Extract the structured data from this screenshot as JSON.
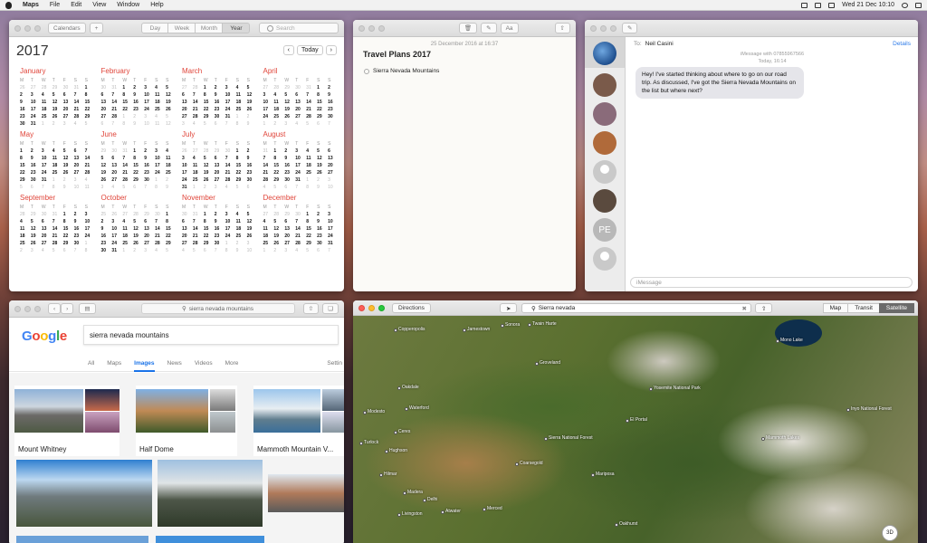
{
  "menubar": {
    "app": "Maps",
    "items": [
      "File",
      "Edit",
      "View",
      "Window",
      "Help"
    ],
    "datetime": "Wed 21 Dec 10:10"
  },
  "calendar": {
    "calendars_btn": "Calendars",
    "add_btn": "+",
    "views": [
      "Day",
      "Week",
      "Month",
      "Year"
    ],
    "selected_view": "Year",
    "search_placeholder": "Search",
    "year": "2017",
    "today": "Today",
    "weekday_header": [
      "M",
      "T",
      "W",
      "T",
      "F",
      "S",
      "S"
    ],
    "months": [
      {
        "name": "January",
        "weeks": [
          [
            "26",
            "27",
            "28",
            "29",
            "30",
            "31",
            "1"
          ],
          [
            "2",
            "3",
            "4",
            "5",
            "6",
            "7",
            "8"
          ],
          [
            "9",
            "10",
            "11",
            "12",
            "13",
            "14",
            "15"
          ],
          [
            "16",
            "17",
            "18",
            "19",
            "20",
            "21",
            "22"
          ],
          [
            "23",
            "24",
            "25",
            "26",
            "27",
            "28",
            "29"
          ],
          [
            "30",
            "31",
            "1",
            "2",
            "3",
            "4",
            "5"
          ]
        ]
      },
      {
        "name": "February",
        "weeks": [
          [
            "30",
            "31",
            "1",
            "2",
            "3",
            "4",
            "5"
          ],
          [
            "6",
            "7",
            "8",
            "9",
            "10",
            "11",
            "12"
          ],
          [
            "13",
            "14",
            "15",
            "16",
            "17",
            "18",
            "19"
          ],
          [
            "20",
            "21",
            "22",
            "23",
            "24",
            "25",
            "26"
          ],
          [
            "27",
            "28",
            "1",
            "2",
            "3",
            "4",
            "5"
          ],
          [
            "6",
            "7",
            "8",
            "9",
            "10",
            "11",
            "12"
          ]
        ]
      },
      {
        "name": "March",
        "weeks": [
          [
            "27",
            "28",
            "1",
            "2",
            "3",
            "4",
            "5"
          ],
          [
            "6",
            "7",
            "8",
            "9",
            "10",
            "11",
            "12"
          ],
          [
            "13",
            "14",
            "15",
            "16",
            "17",
            "18",
            "19"
          ],
          [
            "20",
            "21",
            "22",
            "23",
            "24",
            "25",
            "26"
          ],
          [
            "27",
            "28",
            "29",
            "30",
            "31",
            "1",
            "2"
          ],
          [
            "3",
            "4",
            "5",
            "6",
            "7",
            "8",
            "9"
          ]
        ]
      },
      {
        "name": "April",
        "weeks": [
          [
            "27",
            "28",
            "29",
            "30",
            "31",
            "1",
            "2"
          ],
          [
            "3",
            "4",
            "5",
            "6",
            "7",
            "8",
            "9"
          ],
          [
            "10",
            "11",
            "12",
            "13",
            "14",
            "15",
            "16"
          ],
          [
            "17",
            "18",
            "19",
            "20",
            "21",
            "22",
            "23"
          ],
          [
            "24",
            "25",
            "26",
            "27",
            "28",
            "29",
            "30"
          ],
          [
            "1",
            "2",
            "3",
            "4",
            "5",
            "6",
            "7"
          ]
        ]
      },
      {
        "name": "May",
        "weeks": [
          [
            "1",
            "2",
            "3",
            "4",
            "5",
            "6",
            "7"
          ],
          [
            "8",
            "9",
            "10",
            "11",
            "12",
            "13",
            "14"
          ],
          [
            "15",
            "16",
            "17",
            "18",
            "19",
            "20",
            "21"
          ],
          [
            "22",
            "23",
            "24",
            "25",
            "26",
            "27",
            "28"
          ],
          [
            "29",
            "30",
            "31",
            "1",
            "2",
            "3",
            "4"
          ],
          [
            "5",
            "6",
            "7",
            "8",
            "9",
            "10",
            "11"
          ]
        ]
      },
      {
        "name": "June",
        "weeks": [
          [
            "29",
            "30",
            "31",
            "1",
            "2",
            "3",
            "4"
          ],
          [
            "5",
            "6",
            "7",
            "8",
            "9",
            "10",
            "11"
          ],
          [
            "12",
            "13",
            "14",
            "15",
            "16",
            "17",
            "18"
          ],
          [
            "19",
            "20",
            "21",
            "22",
            "23",
            "24",
            "25"
          ],
          [
            "26",
            "27",
            "28",
            "29",
            "30",
            "1",
            "2"
          ],
          [
            "3",
            "4",
            "5",
            "6",
            "7",
            "8",
            "9"
          ]
        ]
      },
      {
        "name": "July",
        "weeks": [
          [
            "26",
            "27",
            "28",
            "29",
            "30",
            "1",
            "2"
          ],
          [
            "3",
            "4",
            "5",
            "6",
            "7",
            "8",
            "9"
          ],
          [
            "10",
            "11",
            "12",
            "13",
            "14",
            "15",
            "16"
          ],
          [
            "17",
            "18",
            "19",
            "20",
            "21",
            "22",
            "23"
          ],
          [
            "24",
            "25",
            "26",
            "27",
            "28",
            "29",
            "30"
          ],
          [
            "31",
            "1",
            "2",
            "3",
            "4",
            "5",
            "6"
          ]
        ]
      },
      {
        "name": "August",
        "weeks": [
          [
            "31",
            "1",
            "2",
            "3",
            "4",
            "5",
            "6"
          ],
          [
            "7",
            "8",
            "9",
            "10",
            "11",
            "12",
            "13"
          ],
          [
            "14",
            "15",
            "16",
            "17",
            "18",
            "19",
            "20"
          ],
          [
            "21",
            "22",
            "23",
            "24",
            "25",
            "26",
            "27"
          ],
          [
            "28",
            "29",
            "30",
            "31",
            "1",
            "2",
            "3"
          ],
          [
            "4",
            "5",
            "6",
            "7",
            "8",
            "9",
            "10"
          ]
        ]
      },
      {
        "name": "September",
        "weeks": [
          [
            "28",
            "29",
            "30",
            "31",
            "1",
            "2",
            "3"
          ],
          [
            "4",
            "5",
            "6",
            "7",
            "8",
            "9",
            "10"
          ],
          [
            "11",
            "12",
            "13",
            "14",
            "15",
            "16",
            "17"
          ],
          [
            "18",
            "19",
            "20",
            "21",
            "22",
            "23",
            "24"
          ],
          [
            "25",
            "26",
            "27",
            "28",
            "29",
            "30",
            "1"
          ],
          [
            "2",
            "3",
            "4",
            "5",
            "6",
            "7",
            "8"
          ]
        ]
      },
      {
        "name": "October",
        "weeks": [
          [
            "25",
            "26",
            "27",
            "28",
            "29",
            "30",
            "1"
          ],
          [
            "2",
            "3",
            "4",
            "5",
            "6",
            "7",
            "8"
          ],
          [
            "9",
            "10",
            "11",
            "12",
            "13",
            "14",
            "15"
          ],
          [
            "16",
            "17",
            "18",
            "19",
            "20",
            "21",
            "22"
          ],
          [
            "23",
            "24",
            "25",
            "26",
            "27",
            "28",
            "29"
          ],
          [
            "30",
            "31",
            "1",
            "2",
            "3",
            "4",
            "5"
          ]
        ]
      },
      {
        "name": "November",
        "weeks": [
          [
            "30",
            "31",
            "1",
            "2",
            "3",
            "4",
            "5"
          ],
          [
            "6",
            "7",
            "8",
            "9",
            "10",
            "11",
            "12"
          ],
          [
            "13",
            "14",
            "15",
            "16",
            "17",
            "18",
            "19"
          ],
          [
            "20",
            "21",
            "22",
            "23",
            "24",
            "25",
            "26"
          ],
          [
            "27",
            "28",
            "29",
            "30",
            "1",
            "2",
            "3"
          ],
          [
            "4",
            "5",
            "6",
            "7",
            "8",
            "9",
            "10"
          ]
        ]
      },
      {
        "name": "December",
        "weeks": [
          [
            "27",
            "28",
            "29",
            "30",
            "1",
            "2",
            "3"
          ],
          [
            "4",
            "5",
            "6",
            "7",
            "8",
            "9",
            "10"
          ],
          [
            "11",
            "12",
            "13",
            "14",
            "15",
            "16",
            "17"
          ],
          [
            "18",
            "19",
            "20",
            "21",
            "22",
            "23",
            "24"
          ],
          [
            "25",
            "26",
            "27",
            "28",
            "29",
            "30",
            "31"
          ],
          [
            "1",
            "2",
            "3",
            "4",
            "5",
            "6",
            "7"
          ]
        ]
      }
    ]
  },
  "notes": {
    "date": "25 December 2016 at 16:37",
    "title": "Travel Plans 2017",
    "items": [
      "Sierra Nevada Mountains"
    ]
  },
  "messages": {
    "to_label": "To:",
    "recipient": "Neil Casini",
    "details": "Details",
    "service": "iMessage with 07855967566",
    "time": "Today, 16:14",
    "bubble": "Hey! I've started thinking about where to go on our road trip. As discussed, I've got the Sierra Nevada Mountains on the list but where next?",
    "input_placeholder": "iMessage",
    "pe_initials": "PE"
  },
  "safari": {
    "url": "sierra nevada mountains",
    "query": "sierra nevada mountains",
    "logo": "Google",
    "tabs": [
      "All",
      "Maps",
      "Images",
      "News",
      "Videos",
      "More"
    ],
    "selected_tab": "Images",
    "settings": "Settin",
    "results": [
      "Mount Whitney",
      "Half Dome",
      "Mammoth Mountain V..."
    ]
  },
  "maps": {
    "directions": "Directions",
    "search": "Sierra nevada",
    "modes": [
      "Map",
      "Transit",
      "Satellite"
    ],
    "selected_mode": "Satellite",
    "btn3d": "3D",
    "places": [
      "Copperopolis",
      "Jamestown",
      "Sonora",
      "Twain Harte",
      "Groveland",
      "Oakdale",
      "Waterford",
      "Modesto",
      "Turlock",
      "Merced",
      "Atwater",
      "Livingston",
      "Delhi",
      "Mariposa",
      "Oakhurst",
      "Coarsegold",
      "Madera",
      "Yosemite National Park",
      "Mono Lake",
      "Mammoth Lakes",
      "El Portal",
      "Hilmar",
      "Ceres",
      "Hughson",
      "Sierra National Forest",
      "Inyo National Forest"
    ]
  }
}
